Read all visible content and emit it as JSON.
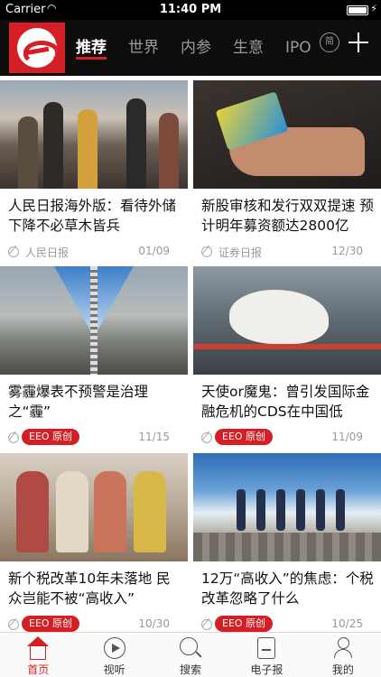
{
  "status_bar": {
    "carrier": "Carrier",
    "time": "11:40 PM"
  },
  "nav": {
    "tabs": [
      {
        "label": "推荐",
        "active": true
      },
      {
        "label": "世界",
        "active": false
      },
      {
        "label": "内参",
        "active": false
      },
      {
        "label": "生意",
        "active": false
      },
      {
        "label": "IPO",
        "active": false
      }
    ],
    "circle_tab_label": "简"
  },
  "articles": [
    {
      "title": "人民日报海外版：看待外储下降不必草木皆兵",
      "source": "人民日报",
      "badge": "",
      "date": "01/09"
    },
    {
      "title": "新股审核和发行双双提速 预计明年募资额达2800亿",
      "source": "证券日报",
      "badge": "",
      "date": "12/30"
    },
    {
      "title": "雾霾爆表不预警是治理之“霾”",
      "source": "",
      "badge": "EEO 原创",
      "date": "11/15"
    },
    {
      "title": "天使or魔鬼：曾引发国际金融危机的CDS在中国低",
      "source": "",
      "badge": "EEO 原创",
      "date": "11/09"
    },
    {
      "title": "新个税改革10年未落地 民众岂能不被“高收入”",
      "source": "",
      "badge": "EEO 原创",
      "date": "10/30"
    },
    {
      "title": "12万“高收入”的焦虑：个税改革忽略了什么",
      "source": "",
      "badge": "EEO 原创",
      "date": "10/25"
    }
  ],
  "tab_bar": [
    {
      "label": "首页",
      "icon": "home-icon",
      "active": true
    },
    {
      "label": "视听",
      "icon": "play-icon",
      "active": false
    },
    {
      "label": "搜索",
      "icon": "search-icon",
      "active": false
    },
    {
      "label": "电子报",
      "icon": "newspaper-icon",
      "active": false
    },
    {
      "label": "我的",
      "icon": "user-icon",
      "active": false
    }
  ],
  "colors": {
    "brand_red": "#d31f25",
    "nav_bg": "#0d0d0d"
  }
}
